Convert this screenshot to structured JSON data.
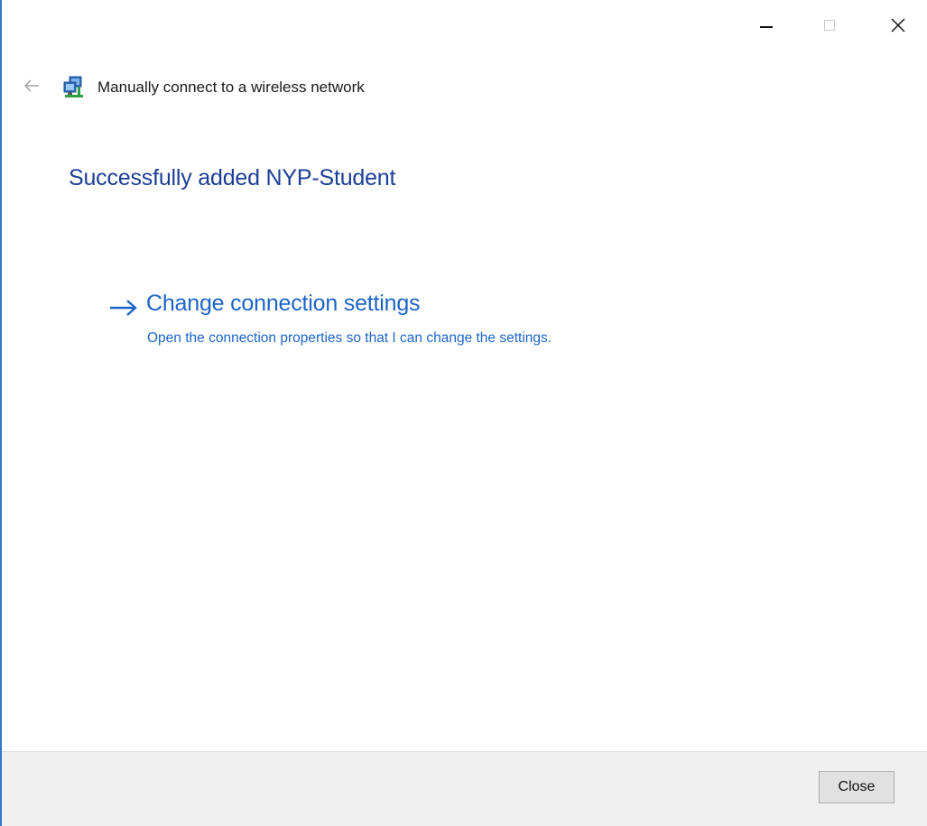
{
  "window": {
    "accent_color": "#2b79d0",
    "controls": {
      "minimize_icon": "minimize-icon",
      "maximize_icon": "maximize-icon",
      "close_icon": "close-x-icon"
    }
  },
  "header": {
    "back_icon": "back-arrow-icon",
    "app_icon": "wireless-network-icon",
    "title": "Manually connect to a wireless network"
  },
  "main": {
    "heading": "Successfully added NYP-Student",
    "heading_color": "#1c3e96",
    "command_link": {
      "icon": "right-arrow-icon",
      "title": "Change connection settings",
      "description": "Open the connection properties so that I can change the settings.",
      "color": "#1e64c8"
    }
  },
  "footer": {
    "close_label": "Close"
  }
}
